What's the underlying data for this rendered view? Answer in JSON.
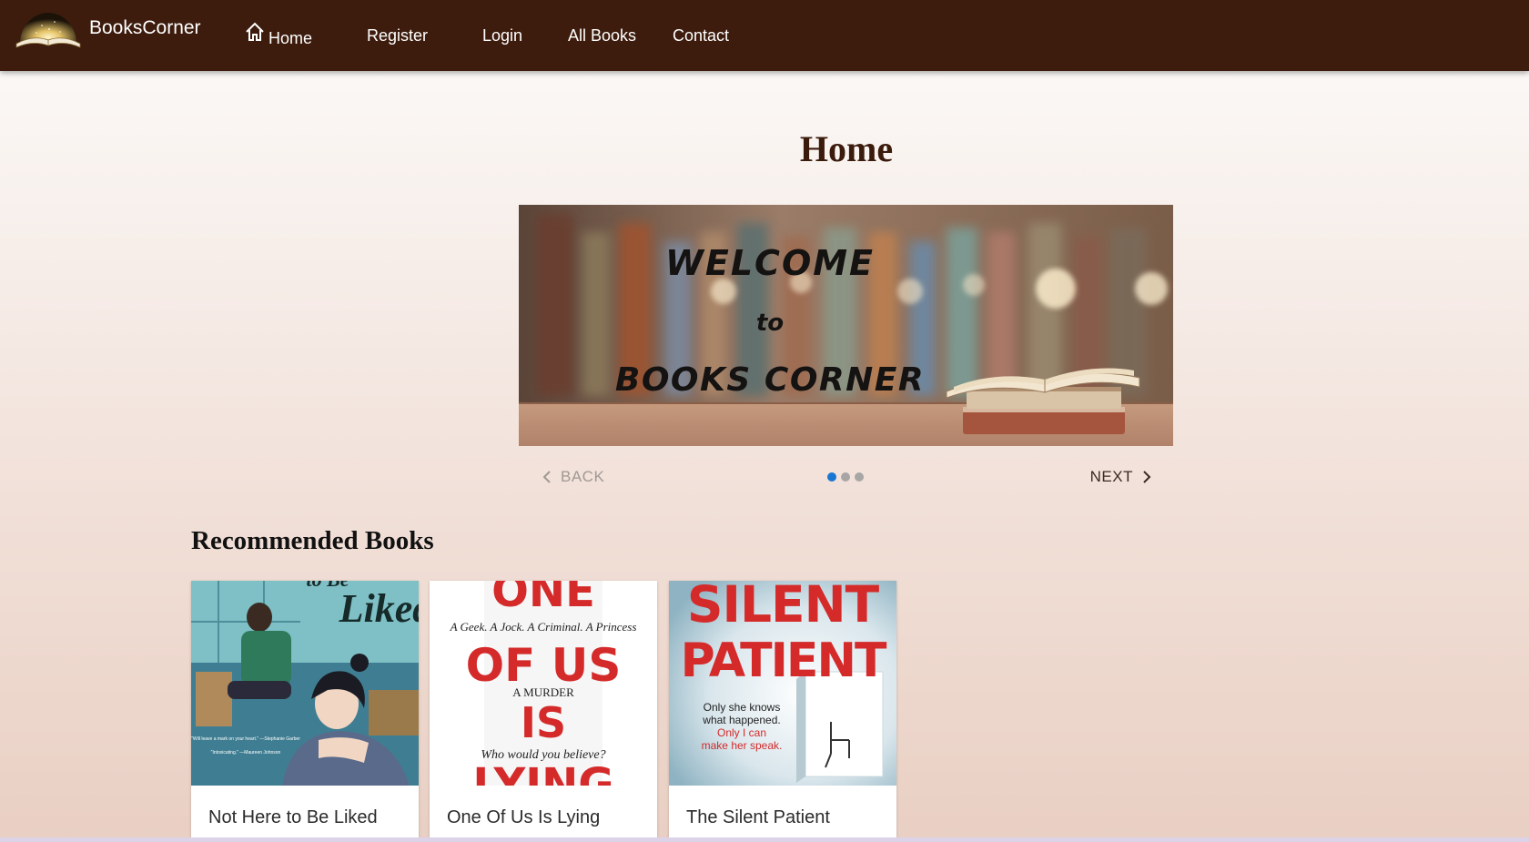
{
  "navbar": {
    "brand": "BooksCorner",
    "items": [
      {
        "label": "Home",
        "icon": "home-icon"
      },
      {
        "label": "Register"
      },
      {
        "label": "Login"
      },
      {
        "label": "All Books"
      },
      {
        "label": "Contact"
      }
    ]
  },
  "main": {
    "title": "Home",
    "carousel": {
      "slide_text": [
        "WELCOME",
        "to",
        "BOOKS CORNER"
      ],
      "back_label": "BACK",
      "next_label": "NEXT",
      "slide_count": 3,
      "active_slide": 1
    },
    "recommended": {
      "heading": "Recommended Books",
      "books": [
        {
          "title": "Not Here to Be Liked",
          "cover_text": [
            "to Be",
            "Liked",
            "\"Will leave a mark on your heart.\" —Stephanie Garber",
            "\"Intoxicating.\" —Maureen Johnson"
          ]
        },
        {
          "title": "One Of Us Is Lying",
          "cover_text": [
            "ONE",
            "A Geek. A Jock. A Criminal. A Princess",
            "OF US",
            "A MURDER",
            "IS",
            "Who would you believe?",
            "LYING"
          ]
        },
        {
          "title": "The Silent Patient",
          "cover_text": [
            "SILENT",
            "PATIENT",
            "Only she knows",
            "what happened.",
            "Only I can",
            "make her speak."
          ]
        }
      ]
    }
  },
  "colors": {
    "navbar_bg": "#3d1c0d",
    "title_color": "#3b1b0c",
    "dot_active": "#1976d2",
    "dot_inactive": "#a8a6a5",
    "cover_red": "#d42a2a"
  }
}
